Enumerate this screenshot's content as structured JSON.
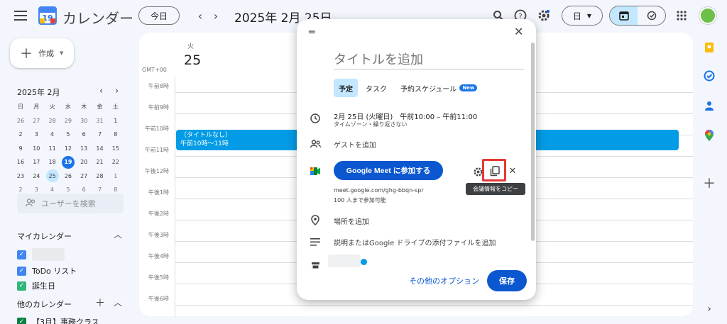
{
  "header": {
    "app_name": "カレンダー",
    "logo_day": "19",
    "today_label": "今日",
    "date_title": "2025年 2月 25日",
    "view_label": "日"
  },
  "sidebar": {
    "create_label": "作成",
    "mini_month": "2025年 2月",
    "weekdays": [
      "日",
      "月",
      "火",
      "水",
      "木",
      "金",
      "土"
    ],
    "weeks": [
      [
        "26",
        "27",
        "28",
        "29",
        "30",
        "31",
        "1"
      ],
      [
        "2",
        "3",
        "4",
        "5",
        "6",
        "7",
        "8"
      ],
      [
        "9",
        "10",
        "11",
        "12",
        "13",
        "14",
        "15"
      ],
      [
        "16",
        "17",
        "18",
        "19",
        "20",
        "21",
        "22"
      ],
      [
        "23",
        "24",
        "25",
        "26",
        "27",
        "28",
        "1"
      ],
      [
        "2",
        "3",
        "4",
        "5",
        "6",
        "7",
        "8"
      ]
    ],
    "search_users_placeholder": "ユーザーを検索",
    "my_calendars_label": "マイカレンダー",
    "my_calendars": [
      {
        "name": "ToDo リスト",
        "color": "#4285f4"
      },
      {
        "name": "誕生日",
        "color": "#33b679"
      }
    ],
    "other_calendars_label": "他のカレンダー",
    "other_calendars": [
      {
        "name": "【3月】事務クラス",
        "color": "#0b8043"
      }
    ]
  },
  "main": {
    "day_name": "火",
    "day_number": "25",
    "timezone": "GMT+00",
    "hours": [
      "午前8時",
      "午前9時",
      "午前10時",
      "午前11時",
      "午後12時",
      "午後1時",
      "午後2時",
      "午後3時",
      "午後4時",
      "午後5時",
      "午後6時"
    ],
    "event": {
      "title": "（タイトルなし）",
      "time": "午前10時～11時",
      "color": "#039be5"
    }
  },
  "dialog": {
    "title_placeholder": "タイトルを追加",
    "tabs": [
      "予定",
      "タスク",
      "予約スケジュール"
    ],
    "new_badge": "New",
    "datetime": "2月 25日 (火曜日)　午前10:00 – 午前11:00",
    "datetime_sub": "タイムゾーン・繰り返さない",
    "add_guests": "ゲストを追加",
    "meet_button": "Google Meet に参加する",
    "copy_tooltip": "会議情報をコピー",
    "meet_link": "meet.google.com/ghg-bbqn-spr",
    "meet_capacity": "100 人まで参加可能",
    "add_location": "場所を追加",
    "add_description": "説明またはGoogle ドライブの添付ファイルを追加",
    "more_options": "その他のオプション",
    "save_label": "保存"
  },
  "colors": {
    "accent": "#0b57d0",
    "selected": "#c2e7ff",
    "highlight": "#e53935"
  }
}
